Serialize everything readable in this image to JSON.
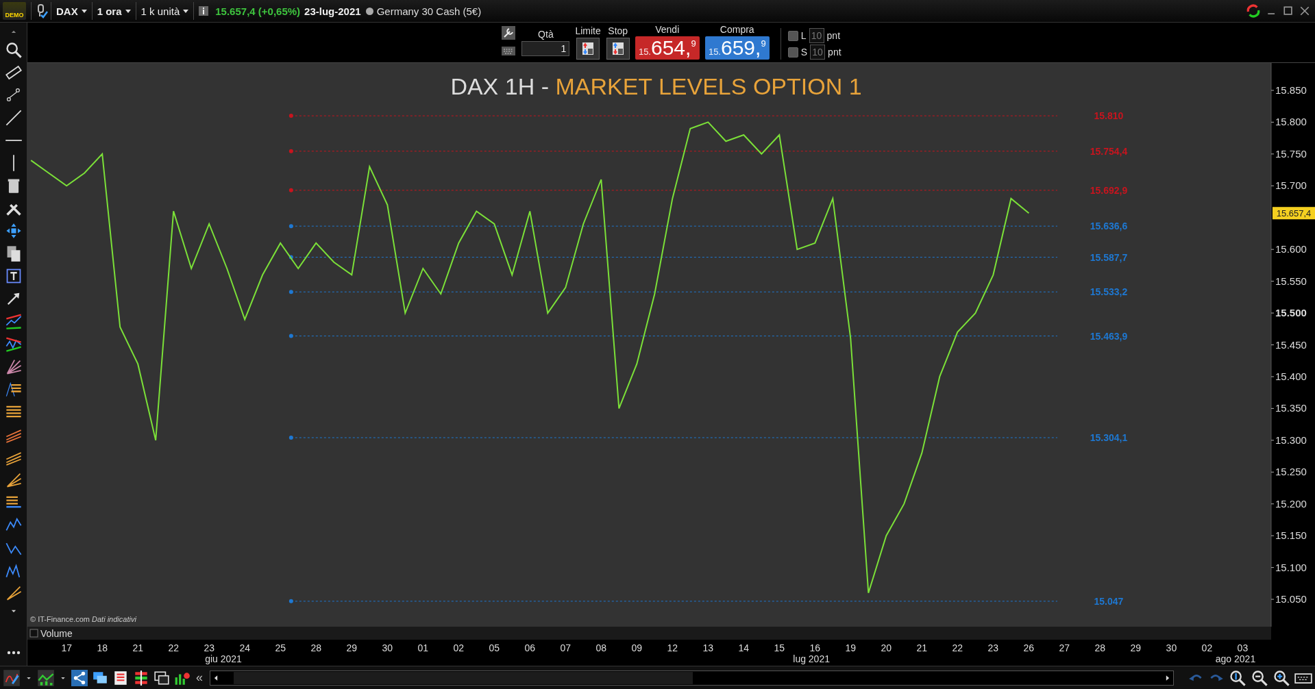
{
  "title_bar": {
    "badge": "DEMO",
    "selectors": [
      {
        "label": "DAX",
        "bold": true
      },
      {
        "label": "1 ora",
        "bold": true
      },
      {
        "label": "1 k unità",
        "bold": false
      }
    ],
    "quote": "15.657,4 (+0,65%)",
    "date": "23-lug-2021",
    "instrument": "Germany 30 Cash (5€)"
  },
  "order_panel": {
    "quantity_label": "Qtà",
    "quantity": "1",
    "limit_label": "Limite",
    "stop_label": "Stop",
    "sell": {
      "label": "Vendi",
      "prefix": "15.",
      "main": "654,",
      "decimal": "9"
    },
    "buy": {
      "label": "Compra",
      "prefix": "15.",
      "main": "659,",
      "decimal": "9"
    },
    "options": [
      {
        "label": "L",
        "value": "10",
        "unit": "pnt",
        "checked": false
      },
      {
        "label": "S",
        "value": "10",
        "unit": "pnt",
        "checked": false
      }
    ]
  },
  "chart": {
    "title_prefix": "DAX 1H -",
    "title_highlight": "MARKET LEVELS OPTION 1",
    "copyright": "© IT-Finance.com *Dati indicativi*",
    "volume": {
      "label": "Volume",
      "checked": false
    },
    "month_labels": [
      {
        "label": "giu 2021"
      },
      {
        "label": "lug 2021"
      },
      {
        "label": "ago 2021"
      }
    ],
    "chart_data": {
      "type": "line",
      "ylim": [
        15007,
        15893
      ],
      "categories": [
        null,
        null,
        "17",
        null,
        "18",
        null,
        "21",
        null,
        "22",
        null,
        "23",
        null,
        "24",
        null,
        "25",
        null,
        "28",
        null,
        "29",
        null,
        "30",
        null,
        "01",
        null,
        "02",
        null,
        "05",
        null,
        "06",
        null,
        "07",
        null,
        "08",
        null,
        "09",
        null,
        "12",
        null,
        "13",
        null,
        "14",
        null,
        "15",
        null,
        "16",
        null,
        "19",
        null,
        "20",
        null,
        "21",
        null,
        "22",
        null,
        "23",
        null,
        "26",
        null,
        "27",
        null,
        "28",
        null,
        "29",
        null,
        "30",
        null,
        "02",
        null,
        "03",
        null
      ],
      "yticks": [
        {
          "value": 15050,
          "label": "15.050"
        },
        {
          "value": 15100,
          "label": "15.100"
        },
        {
          "value": 15150,
          "label": "15.150"
        },
        {
          "value": 15200,
          "label": "15.200"
        },
        {
          "value": 15250,
          "label": "15.250"
        },
        {
          "value": 15300,
          "label": "15.300"
        },
        {
          "value": 15350,
          "label": "15.350"
        },
        {
          "value": 15400,
          "label": "15.400"
        },
        {
          "value": 15450,
          "label": "15.450"
        },
        {
          "value": 15500,
          "label": "15.500"
        },
        {
          "value": 15550,
          "label": "15.550"
        },
        {
          "value": 15600,
          "label": "15.600"
        },
        {
          "value": 15700,
          "label": "15.700"
        },
        {
          "value": 15750,
          "label": "15.750"
        },
        {
          "value": 15800,
          "label": "15.800"
        },
        {
          "value": 15850,
          "label": "15.850"
        }
      ],
      "series": [
        {
          "color": "#7be038",
          "values": [
            15740,
            15720,
            15700,
            15720,
            15750,
            15478,
            15420,
            15300,
            15660,
            15570,
            15640,
            15570,
            15490,
            15560,
            15610,
            15570,
            15610,
            15580,
            15560,
            15730,
            15670,
            15500,
            15570,
            15530,
            15610,
            15660,
            15640,
            15560,
            15660,
            15500,
            15540,
            15640,
            15710,
            15350,
            15420,
            15530,
            15680,
            15790,
            15800,
            15770,
            15780,
            15750,
            15780,
            15600,
            15610,
            15680,
            15460,
            15060,
            15150,
            15200,
            15280,
            15400,
            15470,
            15500,
            15560,
            15680,
            15657,
            null,
            null,
            null,
            null,
            null,
            null,
            null,
            null,
            null,
            null,
            null,
            null,
            null
          ]
        }
      ],
      "ref_lines": [
        {
          "label": "15.810",
          "color": "#c8141e"
        },
        {
          "label": "15.754,4",
          "color": "#c8141e"
        },
        {
          "label": "15.692,9",
          "color": "#c8141e"
        },
        {
          "label": "15.636,6",
          "color": "#1e78d2"
        },
        {
          "label": "15.587,7",
          "color": "#1e78d2"
        },
        {
          "label": "15.533,2",
          "color": "#1e78d2"
        },
        {
          "label": "15.463,9",
          "color": "#1e78d2"
        },
        {
          "label": "15.304,1",
          "color": "#1e78d2"
        },
        {
          "label": "15.047",
          "color": "#1e78d2"
        }
      ],
      "annotations": [
        "15.657,4"
      ]
    }
  },
  "bottom_toolbar": {
    "collapse_glyph": "«"
  }
}
